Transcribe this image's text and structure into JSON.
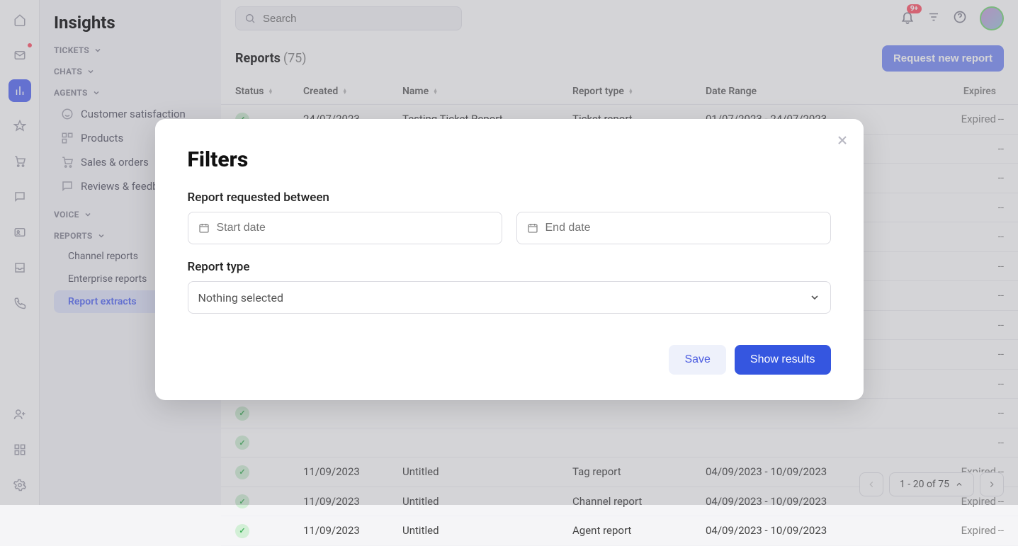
{
  "sidebar": {
    "title": "Insights",
    "sections": {
      "tickets": "TICKETS",
      "chats": "CHATS",
      "agents": "AGENTS",
      "voice": "VOICE",
      "reports": "REPORTS"
    },
    "agents_items": [
      "Customer satisfaction",
      "Products",
      "Sales & orders",
      "Reviews & feedback"
    ],
    "reports_items": [
      "Channel reports",
      "Enterprise reports",
      "Report extracts"
    ]
  },
  "topbar": {
    "search_placeholder": "Search",
    "notif_badge": "9+"
  },
  "page": {
    "title": "Reports",
    "count": "(75)",
    "request_btn": "Request new report"
  },
  "columns": {
    "status": "Status",
    "created": "Created",
    "name": "Name",
    "type": "Report type",
    "range": "Date Range",
    "expires": "Expires"
  },
  "rows": [
    {
      "status": "ok",
      "created": "24/07/2023",
      "name": "Testing Ticket Report",
      "type": "Ticket report",
      "range": "01/07/2023 - 24/07/2023",
      "expires": "Expired",
      "last": "--"
    },
    {
      "status": "ok",
      "created": "",
      "name": "",
      "type": "",
      "range": "",
      "expires": "",
      "last": "--"
    },
    {
      "status": "ok",
      "created": "",
      "name": "",
      "type": "",
      "range": "",
      "expires": "",
      "last": "--"
    },
    {
      "status": "ok",
      "created": "",
      "name": "",
      "type": "",
      "range": "",
      "expires": "",
      "last": "--"
    },
    {
      "status": "err",
      "created": "",
      "name": "",
      "type": "",
      "range": "",
      "expires": "",
      "last": "--"
    },
    {
      "status": "ok",
      "created": "",
      "name": "",
      "type": "",
      "range": "",
      "expires": "",
      "last": "--"
    },
    {
      "status": "ok",
      "created": "",
      "name": "",
      "type": "",
      "range": "",
      "expires": "",
      "last": "--"
    },
    {
      "status": "ok",
      "created": "",
      "name": "",
      "type": "",
      "range": "",
      "expires": "",
      "last": "--"
    },
    {
      "status": "ok",
      "created": "",
      "name": "",
      "type": "",
      "range": "",
      "expires": "",
      "last": "--"
    },
    {
      "status": "ok",
      "created": "",
      "name": "",
      "type": "",
      "range": "",
      "expires": "",
      "last": "--"
    },
    {
      "status": "ok",
      "created": "",
      "name": "",
      "type": "",
      "range": "",
      "expires": "",
      "last": "--"
    },
    {
      "status": "ok",
      "created": "",
      "name": "",
      "type": "",
      "range": "",
      "expires": "",
      "last": "--"
    },
    {
      "status": "ok",
      "created": "11/09/2023",
      "name": "Untitled",
      "type": "Tag report",
      "range": "04/09/2023 - 10/09/2023",
      "expires": "Expired",
      "last": "--"
    },
    {
      "status": "ok",
      "created": "11/09/2023",
      "name": "Untitled",
      "type": "Channel report",
      "range": "04/09/2023 - 10/09/2023",
      "expires": "Expired",
      "last": "--"
    },
    {
      "status": "ok",
      "created": "11/09/2023",
      "name": "Untitled",
      "type": "Agent report",
      "range": "04/09/2023 - 10/09/2023",
      "expires": "Expired",
      "last": "--"
    }
  ],
  "pager": {
    "range": "1 - 20 of 75"
  },
  "modal": {
    "title": "Filters",
    "label_between": "Report requested between",
    "start_placeholder": "Start date",
    "end_placeholder": "End date",
    "label_type": "Report type",
    "type_placeholder": "Nothing selected",
    "save": "Save",
    "show": "Show results"
  }
}
